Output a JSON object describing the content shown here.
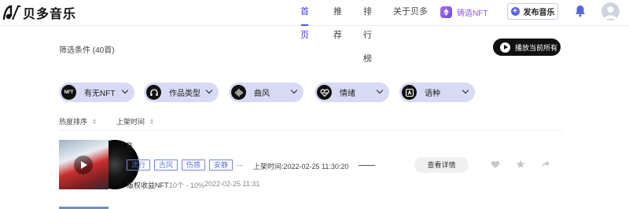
{
  "app": {
    "name": "贝多音乐"
  },
  "nav": [
    {
      "label": "首页",
      "active": true
    },
    {
      "label": "推荐"
    },
    {
      "label": "排行榜"
    },
    {
      "label": "关于贝多"
    }
  ],
  "header": {
    "nft_mint_label": "铸造NFT",
    "publish_label": "发布音乐",
    "accent_color": "#4a55e8",
    "nft_color": "#8c56e8"
  },
  "filter": {
    "summary": "筛选条件 (40首)",
    "play_all_label": "播放当前所有",
    "chips": [
      {
        "label": "有无NFT",
        "icon": "nft-badge-icon",
        "icon_text": "NFT"
      },
      {
        "label": "作品类型",
        "icon": "headphones-icon"
      },
      {
        "label": "曲风",
        "icon": "waveform-icon"
      },
      {
        "label": "情绪",
        "icon": "heart-pulse-icon"
      },
      {
        "label": "语种",
        "icon": "language-a-icon"
      }
    ],
    "chip_color": "#d8daf5"
  },
  "sort": [
    {
      "label": "热度排序"
    },
    {
      "label": "上架时间"
    }
  ],
  "songs": [
    {
      "title": "B",
      "tags": [
        "流行",
        "古风",
        "伤感",
        "安静"
      ],
      "more": "...",
      "listed_time": "上架时间:2022-02-25 11:30:20",
      "detail_label": "查看详情",
      "rights_label": "版权收益NFT",
      "share_info": "10个 - 10%",
      "rights_time": "2022-02-25 11:31"
    }
  ]
}
